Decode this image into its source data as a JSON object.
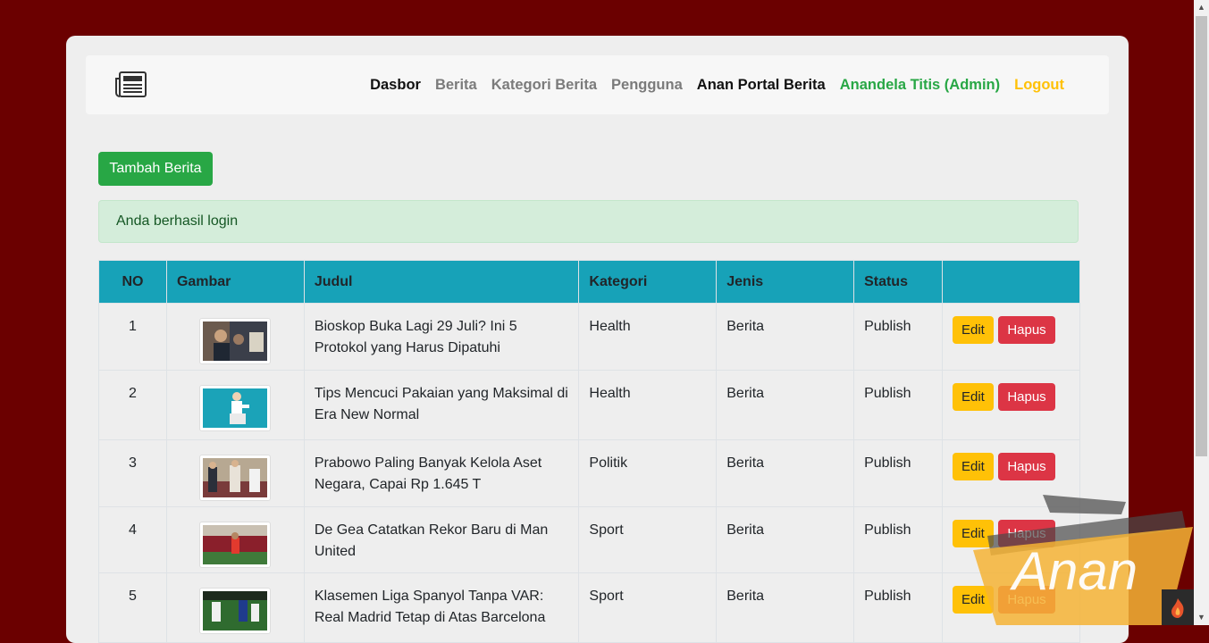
{
  "navbar": {
    "logo_icon": "newspaper-icon",
    "items": [
      {
        "label": "Dasbor"
      },
      {
        "label": "Berita"
      },
      {
        "label": "Kategori Berita"
      },
      {
        "label": "Pengguna"
      }
    ],
    "brand": "Anan Portal Berita",
    "user": "Anandela Titis (Admin)",
    "logout": "Logout"
  },
  "toolbar": {
    "add_label": "Tambah Berita"
  },
  "alert": {
    "message": "Anda berhasil login"
  },
  "table": {
    "headers": [
      "NO",
      "Gambar",
      "Judul",
      "Kategori",
      "Jenis",
      "Status",
      ""
    ],
    "edit_label": "Edit",
    "delete_label": "Hapus",
    "rows": [
      {
        "no": "1",
        "title": "Bioskop Buka Lagi 29 Juli? Ini 5 Protokol yang Harus Dipatuhi",
        "category": "Health",
        "type": "Berita",
        "status": "Publish"
      },
      {
        "no": "2",
        "title": "Tips Mencuci Pakaian yang Maksimal di Era New Normal",
        "category": "Health",
        "type": "Berita",
        "status": "Publish"
      },
      {
        "no": "3",
        "title": "Prabowo Paling Banyak Kelola Aset Negara, Capai Rp 1.645 T",
        "category": "Politik",
        "type": "Berita",
        "status": "Publish"
      },
      {
        "no": "4",
        "title": "De Gea Catatkan Rekor Baru di Man United",
        "category": "Sport",
        "type": "Berita",
        "status": "Publish"
      },
      {
        "no": "5",
        "title": "Klasemen Liga Spanyol Tanpa VAR: Real Madrid Tetap di Atas Barcelona",
        "category": "Sport",
        "type": "Berita",
        "status": "Publish"
      }
    ]
  },
  "watermark": {
    "text": "Anan"
  },
  "colors": {
    "background": "#6b0000",
    "header": "#17a2b8",
    "success": "#28a745",
    "warning": "#ffc107",
    "danger": "#dc3545"
  }
}
